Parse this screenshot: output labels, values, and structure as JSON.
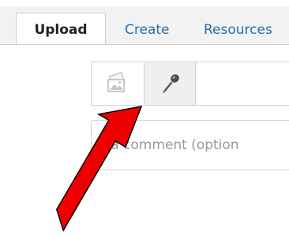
{
  "tabs": {
    "upload_label": "Upload",
    "create_label": "Create",
    "resources_label": "Resources"
  },
  "toolbar": {
    "buttons": [
      {
        "icon": "image-icon"
      },
      {
        "icon": "microphone-icon"
      }
    ]
  },
  "comment": {
    "placeholder": "d a comment (option"
  },
  "colors": {
    "tab_link": "#2a6ca8",
    "arrow_fill": "#ee0000",
    "arrow_stroke": "#000000",
    "tab_bar_bg": "#f2f2f2"
  }
}
